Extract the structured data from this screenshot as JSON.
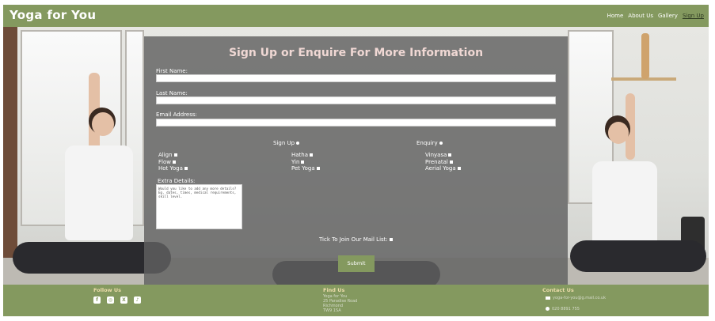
{
  "header": {
    "brand": "Yoga for You",
    "nav": [
      {
        "label": "Home",
        "active": false
      },
      {
        "label": "About Us",
        "active": false
      },
      {
        "label": "Gallery",
        "active": false
      },
      {
        "label": "Sign Up",
        "active": true
      }
    ]
  },
  "form": {
    "title": "Sign Up or Enquire For More Information",
    "first_name_label": "First Name:",
    "last_name_label": "Last Name:",
    "email_label": "Email Address:",
    "sign_up_label": "Sign Up",
    "enquiry_label": "Enquiry",
    "classes_col1": [
      "Align",
      "Flow",
      "Hot Yoga"
    ],
    "classes_col2": [
      "Hatha",
      "Yin",
      "Pet Yoga"
    ],
    "classes_col3": [
      "Vinyasa",
      "Prenatal",
      "Aerial Yoga"
    ],
    "extra_details_label": "Extra Details:",
    "extra_details_placeholder": "Would you like to add any more details? Eg. dates, times, medical requirements, skill level.",
    "mail_list_label": "Tick To Join Our Mail List:",
    "submit_label": "Submit"
  },
  "footer": {
    "follow_title": "Follow Us",
    "social_icons": [
      "facebook-icon",
      "instagram-icon",
      "x-icon",
      "tiktok-icon"
    ],
    "find_title": "Find Us",
    "address": [
      "Yoga for You",
      "25 Paradise Road",
      "Richmond",
      "TW9 1SA"
    ],
    "contact_title": "Contact Us",
    "email": "yoga-for-you@g.mail.co.uk",
    "phone": "020 8891 755"
  },
  "colors": {
    "brand_green": "#84995f",
    "title_pink": "#f0d8d4",
    "overlay_grey": "#606060"
  }
}
